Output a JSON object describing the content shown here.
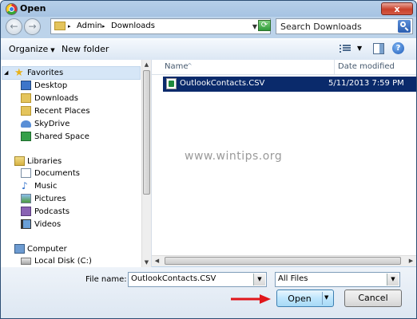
{
  "window": {
    "title": "Open",
    "close_glyph": "x"
  },
  "nav": {
    "back_glyph": "←",
    "forward_glyph": "→",
    "breadcrumbs": [
      "Admin",
      "Downloads"
    ],
    "separator": "▸",
    "search_placeholder": "Search Downloads"
  },
  "toolbar": {
    "organize_label": "Organize",
    "new_folder_label": "New folder",
    "help_glyph": "?"
  },
  "sidebar": {
    "groups": [
      {
        "label": "Favorites",
        "items": [
          "Desktop",
          "Downloads",
          "Recent Places",
          "SkyDrive",
          "Shared Space"
        ]
      },
      {
        "label": "Libraries",
        "items": [
          "Documents",
          "Music",
          "Pictures",
          "Podcasts",
          "Videos"
        ]
      },
      {
        "label": "Computer",
        "items": [
          "Local Disk (C:)"
        ]
      }
    ]
  },
  "columns": {
    "name": "Name",
    "date_modified": "Date modified",
    "sort_glyph": "^"
  },
  "files": [
    {
      "name": "OutlookContacts.CSV",
      "date_modified": "5/11/2013 7:59 PM",
      "selected": true
    }
  ],
  "watermark": "www.wintips.org",
  "bottom": {
    "file_name_label": "File name:",
    "file_name_value": "OutlookContacts.CSV",
    "file_type_value": "All Files",
    "open_label": "Open",
    "cancel_label": "Cancel"
  },
  "colors": {
    "selection": "#0a2a6b",
    "frame": "#bcd3ea",
    "annotation_arrow": "#e0161b"
  }
}
